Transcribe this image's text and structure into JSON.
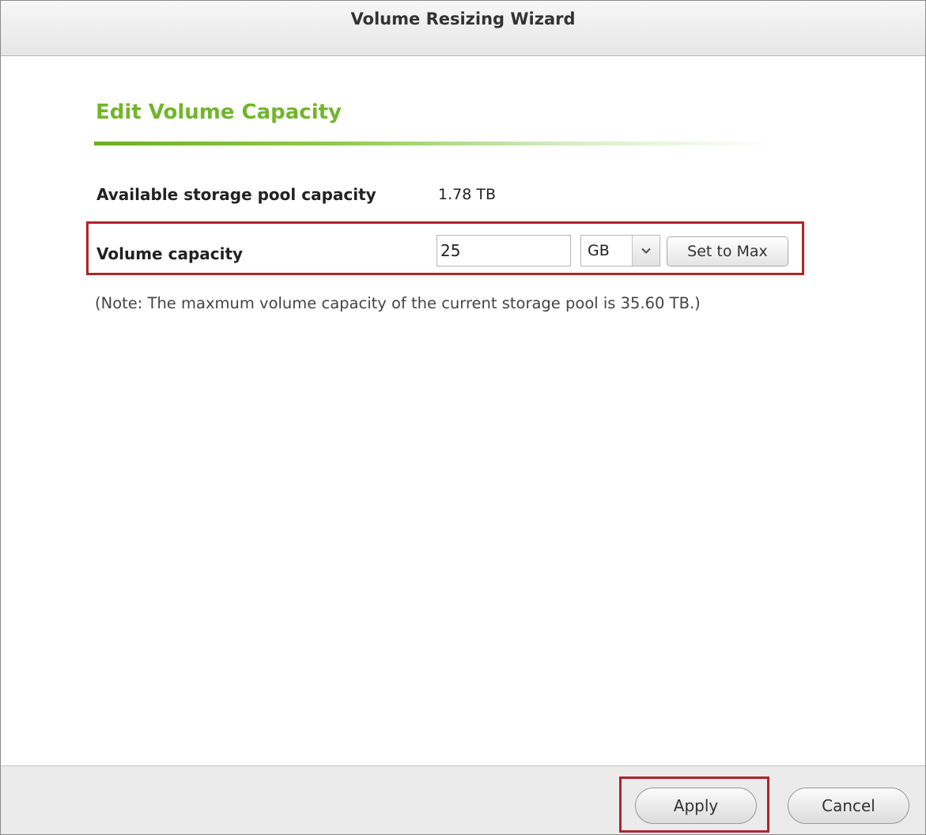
{
  "window": {
    "title": "Volume Resizing Wizard"
  },
  "section": {
    "title": "Edit Volume Capacity"
  },
  "available": {
    "label": "Available storage pool capacity",
    "value": "1.78 TB"
  },
  "volume": {
    "label": "Volume capacity",
    "input_value": "25",
    "unit_selected": "GB",
    "set_max_label": "Set to Max"
  },
  "note": "(Note: The maxmum volume capacity of the current storage pool is 35.60 TB.)",
  "footer": {
    "apply_label": "Apply",
    "cancel_label": "Cancel"
  },
  "colors": {
    "accent_green": "#72b52a",
    "highlight_red": "#b1232b"
  },
  "icons": {
    "unit_dropdown": "chevron-down-icon"
  }
}
